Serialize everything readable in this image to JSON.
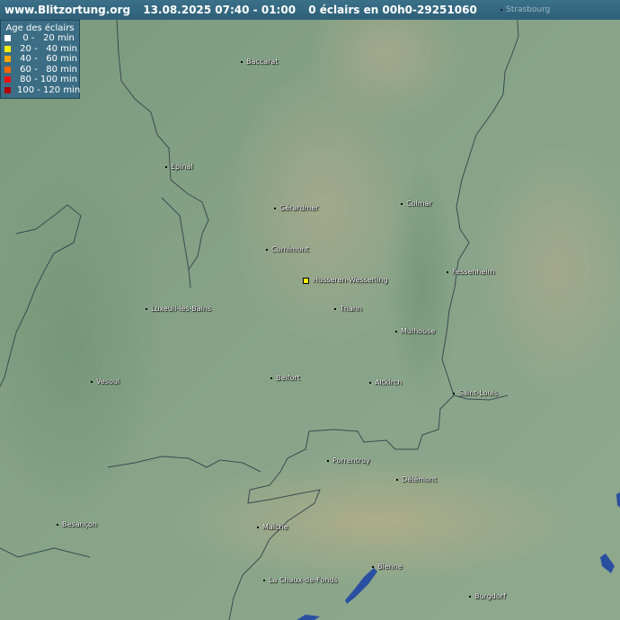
{
  "header": {
    "site": "www.Blitzortung.org",
    "datetime": "13.08.2025  07:40 - 01:00",
    "summary": "0 éclairs en 00h0-29251060"
  },
  "legend": {
    "title": "Age des éclairs",
    "rows": [
      {
        "label": "  0 -   20 min",
        "color": "#ffffff"
      },
      {
        "label": " 20 -   40 min",
        "color": "#ffee00"
      },
      {
        "label": " 40 -   60 min",
        "color": "#ffa500"
      },
      {
        "label": " 60 -   80 min",
        "color": "#ff6600"
      },
      {
        "label": " 80 - 100 min",
        "color": "#ee1111"
      },
      {
        "label": "100 - 120 min",
        "color": "#b00000"
      }
    ]
  },
  "station": {
    "name": "Husseren-Wesserling",
    "color": "#ffee00"
  },
  "corner_city": "Strasbourg",
  "cities": [
    {
      "name": "Baccarat"
    },
    {
      "name": "Epinal"
    },
    {
      "name": "Gérardmer"
    },
    {
      "name": "Colmar"
    },
    {
      "name": "Cornimont"
    },
    {
      "name": "Fessenheim"
    },
    {
      "name": "Luxeuil-les-Bains"
    },
    {
      "name": "Thann"
    },
    {
      "name": "Mulhouse"
    },
    {
      "name": "Vesoul"
    },
    {
      "name": "Belfort"
    },
    {
      "name": "Altkirch"
    },
    {
      "name": "Saint-Louis"
    },
    {
      "name": "Porrentruy"
    },
    {
      "name": "Délémont"
    },
    {
      "name": "Besançon"
    },
    {
      "name": "Maîche"
    },
    {
      "name": "Bienne"
    },
    {
      "name": "La Chaux-de-Fonds"
    },
    {
      "name": "Burgdorf"
    }
  ],
  "colors": {
    "land": "#7f9c80",
    "border": "#3d4a50",
    "lake": "#2b4fa0",
    "header": "#34677f"
  }
}
